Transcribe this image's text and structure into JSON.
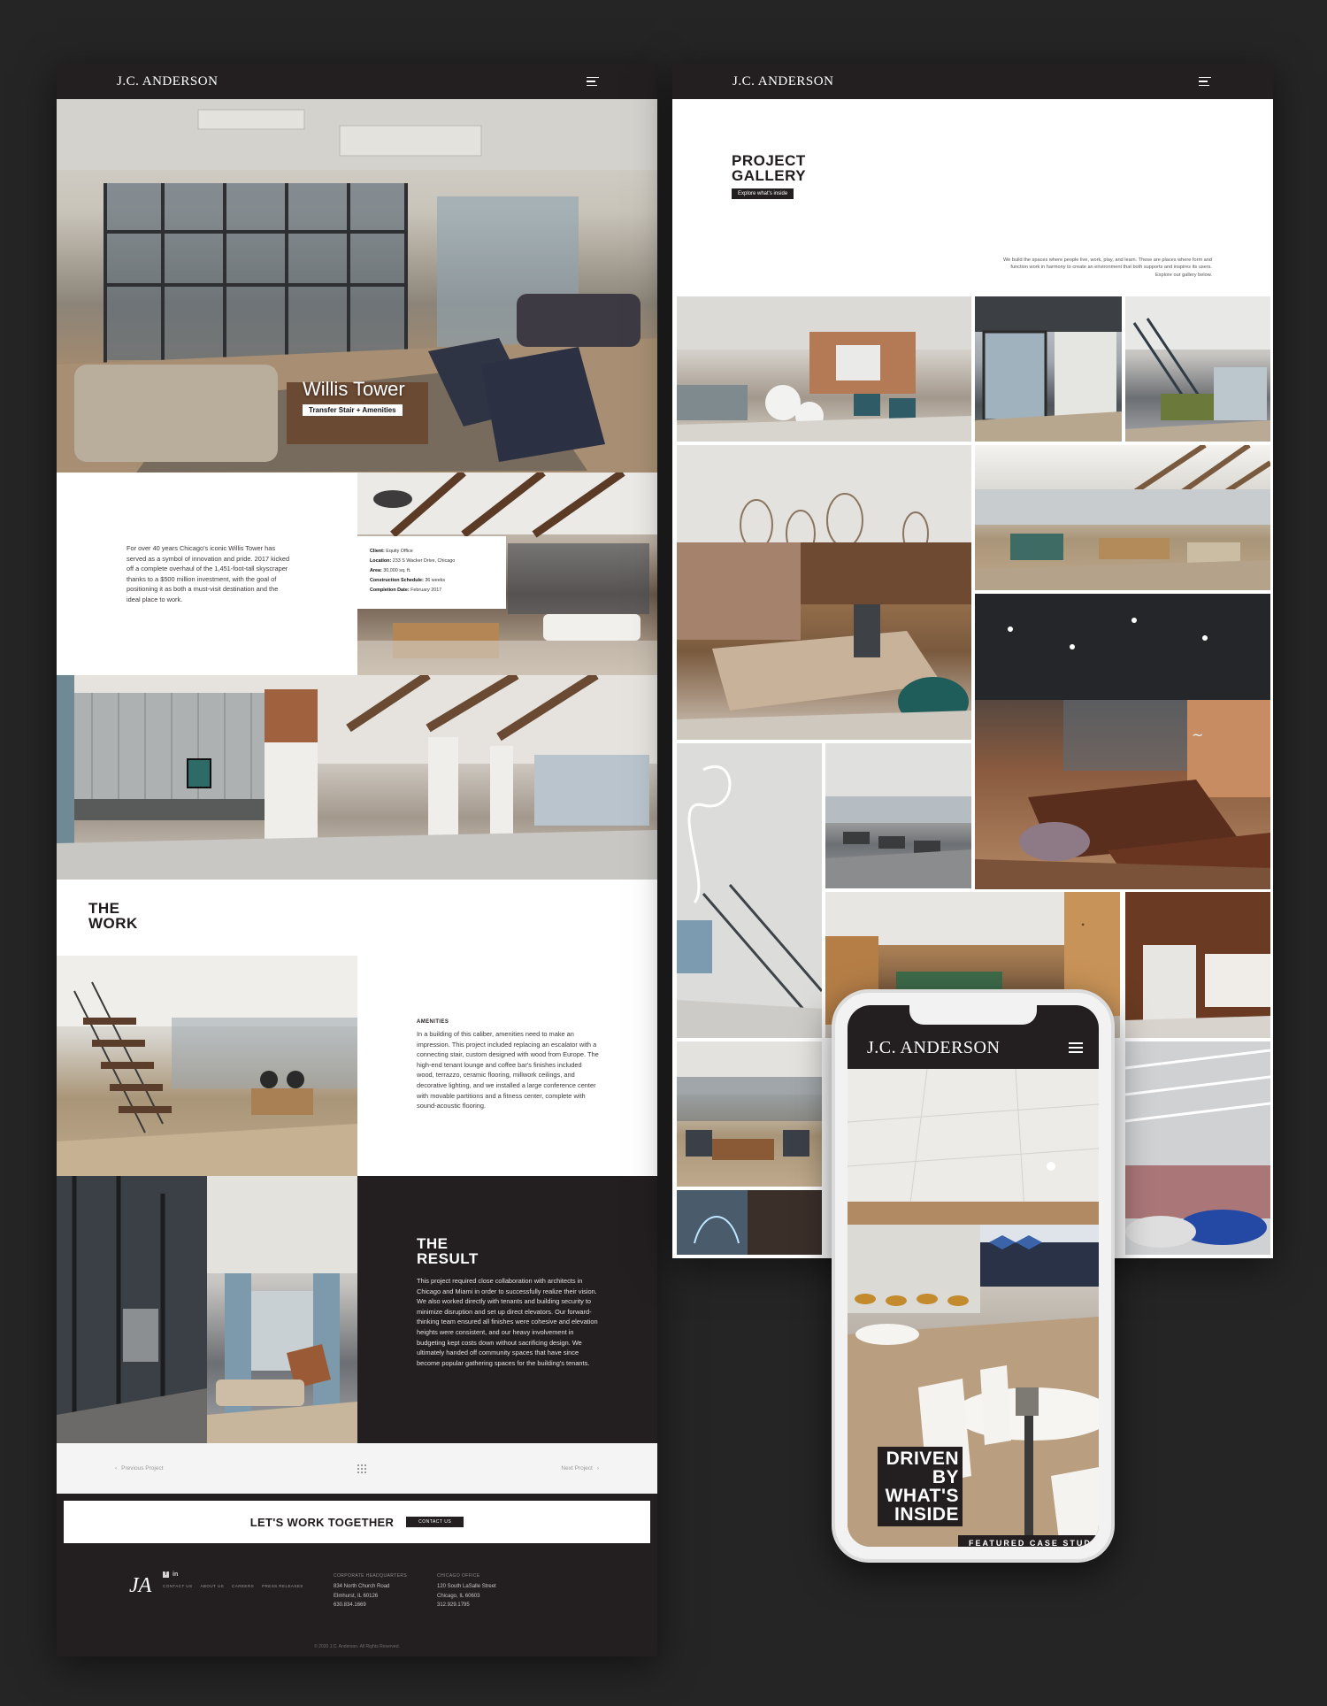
{
  "brand": {
    "logo_text": "J.C. ANDERSON"
  },
  "project_page": {
    "hero": {
      "title": "Willis Tower",
      "subtitle": "Transfer Stair + Amenities"
    },
    "intro_text": "For over 40 years Chicago's iconic Willis Tower has served as a symbol of innovation and pride. 2017 kicked off a complete overhaul of the 1,451-foot-tall skyscraper thanks to a $500 million investment, with the goal of positioning it as both a must-visit destination and the ideal place to work.",
    "info": {
      "client_label": "Client:",
      "client": "Equity Office",
      "location_label": "Location:",
      "location": "233 S Wacker Drive, Chicago",
      "area_label": "Area:",
      "area": "30,000 sq. ft.",
      "schedule_label": "Construction Schedule:",
      "schedule": "36 weeks",
      "completion_label": "Completion Date:",
      "completion": "February 2017"
    },
    "work": {
      "heading_line1": "THE",
      "heading_line2": "WORK",
      "label": "AMENITIES",
      "text": "In a building of this caliber, amenities need to make an impression. This project included replacing an escalator with a connecting stair, custom designed with wood from Europe. The high-end tenant lounge and coffee bar's finishes included wood, terrazzo, ceramic flooring, millwork ceilings, and decorative lighting, and we installed a large conference center with movable partitions and a fitness center, complete with sound-acoustic flooring."
    },
    "result": {
      "heading_line1": "THE",
      "heading_line2": "RESULT",
      "text": "This project required close collaboration with architects in Chicago and Miami in order to successfully realize their vision. We also worked directly with tenants and building security to minimize disruption and set up direct elevators. Our forward-thinking team ensured all finishes were cohesive and elevation heights were consistent, and our heavy involvement in budgeting kept costs down without sacrificing design. We ultimately handed off community spaces that have since become popular gathering spaces for the building's tenants."
    },
    "pager": {
      "previous": "Previous Project",
      "next": "Next Project"
    },
    "cta": {
      "text": "LET'S WORK TOGETHER",
      "button": "CONTACT US"
    },
    "footer": {
      "links": [
        "CONTACT US",
        "ABOUT US",
        "CAREERS",
        "PRESS RELEASES"
      ],
      "hq_label": "CORPORATE HEADQUARTERS",
      "hq_line1": "834 North Church Road",
      "hq_line2": "Elmhurst, IL 60126",
      "hq_phone": "630.834.1669",
      "chicago_label": "CHICAGO OFFICE",
      "chicago_line1": "120 South LaSalle Street",
      "chicago_line2": "Chicago, IL 60603",
      "chicago_phone": "312.929.1795",
      "copyright": "© 2020 J.C. Anderson. All Rights Reserved."
    }
  },
  "gallery_page": {
    "heading_line1": "PROJECT",
    "heading_line2": "GALLERY",
    "button": "Explore what's inside",
    "intro_text": "We build the spaces where people live, work, play, and learn. These are places where form and function work in harmony to create an environment that both supports and inspires its users. Explore our gallery below."
  },
  "mobile": {
    "headline_line1": "DRIVEN",
    "headline_line2": "BY",
    "headline_line3": "WHAT'S",
    "headline_line4": "INSIDE",
    "bottom_bar": "FEATURED CASE STUDY"
  },
  "colors": {
    "background": "#262525",
    "dark": "#231f20",
    "white": "#ffffff"
  }
}
